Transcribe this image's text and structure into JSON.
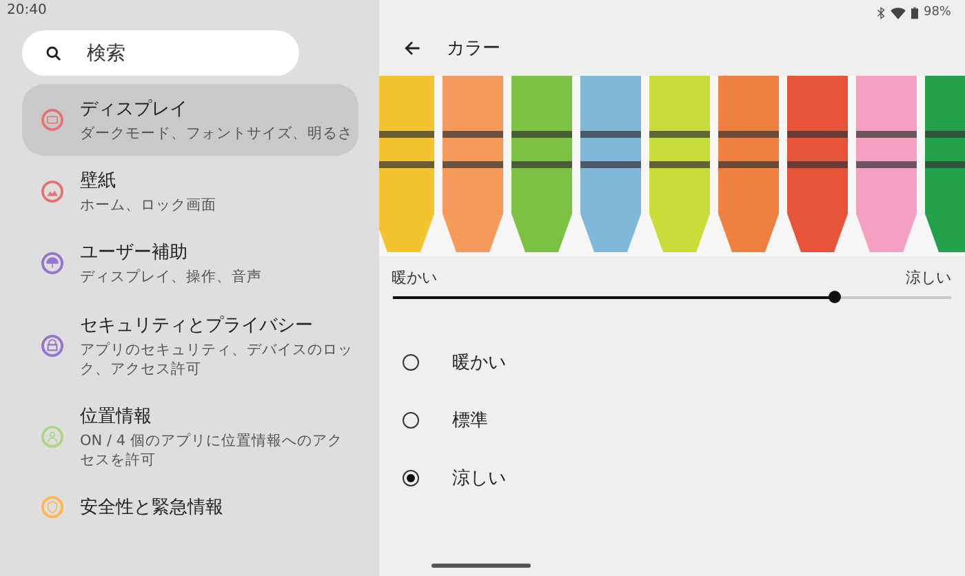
{
  "status_bar": {
    "time": "20:40",
    "battery": "98%"
  },
  "search": {
    "placeholder": "検索"
  },
  "sidebar": {
    "items": [
      {
        "title": "ディスプレイ",
        "subtitle": "ダークモード、フォントサイズ、明るさ",
        "selected": true,
        "kind": "display",
        "color": "#e57373"
      },
      {
        "title": "壁紙",
        "subtitle": "ホーム、ロック画面",
        "selected": false,
        "kind": "wallpaper",
        "color": "#e57373"
      },
      {
        "title": "ユーザー補助",
        "subtitle": "ディスプレイ、操作、音声",
        "selected": false,
        "kind": "accessibility",
        "color": "#9575cd"
      },
      {
        "title": "セキュリティとプライバシー",
        "subtitle": "アプリのセキュリティ、デバイスのロック、アクセス許可",
        "selected": false,
        "kind": "security",
        "color": "#9575cd"
      },
      {
        "title": "位置情報",
        "subtitle": "ON / 4 個のアプリに位置情報へのアクセスを許可",
        "selected": false,
        "kind": "location",
        "color": "#aed581"
      },
      {
        "title": "安全性と緊急情報",
        "selected": false,
        "kind": "safety",
        "color": "#ffb74d"
      }
    ]
  },
  "page": {
    "title": "カラー",
    "slider": {
      "min_label": "暖かい",
      "max_label": "涼しい",
      "level": 0.79
    },
    "options": [
      {
        "label": "暖かい",
        "selected": false
      },
      {
        "label": "標準",
        "selected": false
      },
      {
        "label": "涼しい",
        "selected": true
      }
    ]
  }
}
